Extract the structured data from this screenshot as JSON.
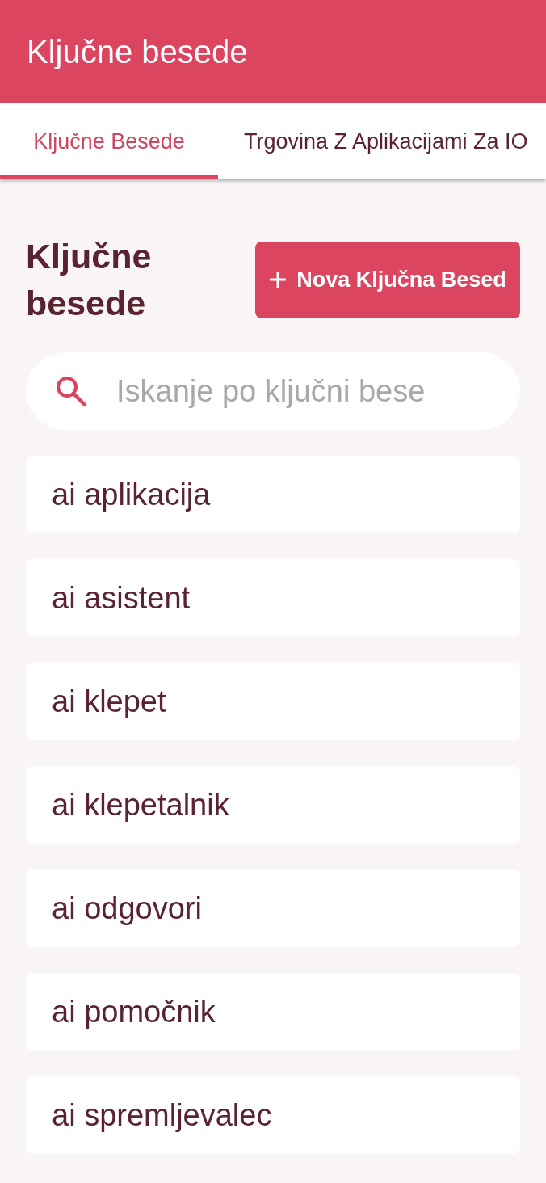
{
  "app_bar": {
    "title": "Ključne besede"
  },
  "tabs": [
    {
      "label": "Ključne Besede",
      "selected": true
    },
    {
      "label": "Trgovina Z Aplikacijami Za IO",
      "selected": false
    }
  ],
  "page": {
    "heading": "Ključne besede",
    "new_button": "Nova Ključna Besed"
  },
  "search": {
    "placeholder": "Iskanje po ključni bese"
  },
  "keywords": [
    {
      "text": "ai aplikacija"
    },
    {
      "text": "ai asistent"
    },
    {
      "text": "ai klepet"
    },
    {
      "text": "ai klepetalnik"
    },
    {
      "text": "ai odgovori"
    },
    {
      "text": "ai pomočnik"
    },
    {
      "text": "ai spremljevalec"
    }
  ]
}
